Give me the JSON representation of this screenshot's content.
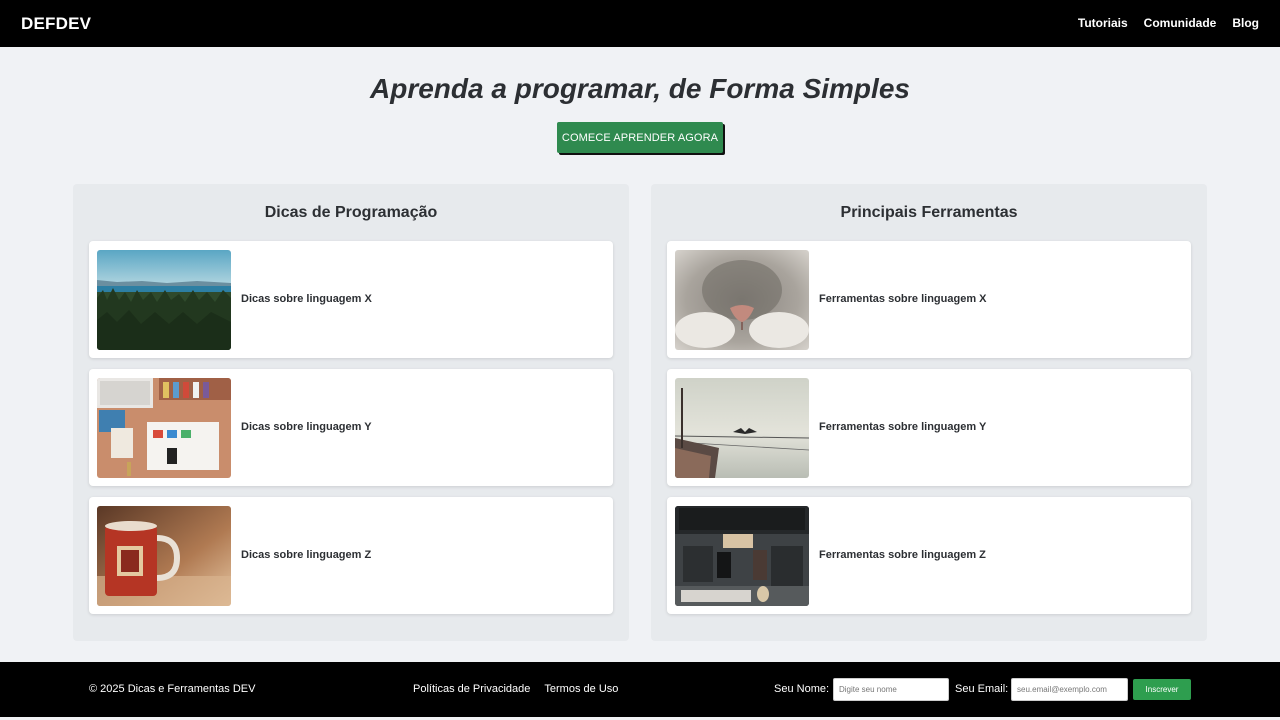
{
  "header": {
    "brand": "DEFDEV",
    "nav": [
      "Tutoriais",
      "Comunidade",
      "Blog"
    ]
  },
  "hero": {
    "title": "Aprenda a programar, de Forma Simples",
    "cta_label": "COMECE APRENDER AGORA"
  },
  "sections": [
    {
      "title": "Dicas de Programação",
      "items": [
        "Dicas sobre linguagem X",
        "Dicas sobre linguagem Y",
        "Dicas sobre linguagem Z"
      ]
    },
    {
      "title": "Principais Ferramentas",
      "items": [
        "Ferramentas sobre linguagem X",
        "Ferramentas sobre linguagem Y",
        "Ferramentas sobre linguagem Z"
      ]
    }
  ],
  "footer": {
    "copyright": "© 2025 Dicas e Ferramentas DEV",
    "links": [
      "Políticas de Privacidade",
      "Termos de Uso"
    ],
    "name_label": "Seu Nome:",
    "name_placeholder": "Digite seu nome",
    "email_label": "Seu Email:",
    "email_placeholder": "seu.email@exemplo.com",
    "subscribe_label": "Inscrever"
  },
  "colors": {
    "header_bg": "#000000",
    "page_bg": "#f0f2f5",
    "cta_bg": "#2f8a4f",
    "subscribe_bg": "#2e9e4f"
  }
}
